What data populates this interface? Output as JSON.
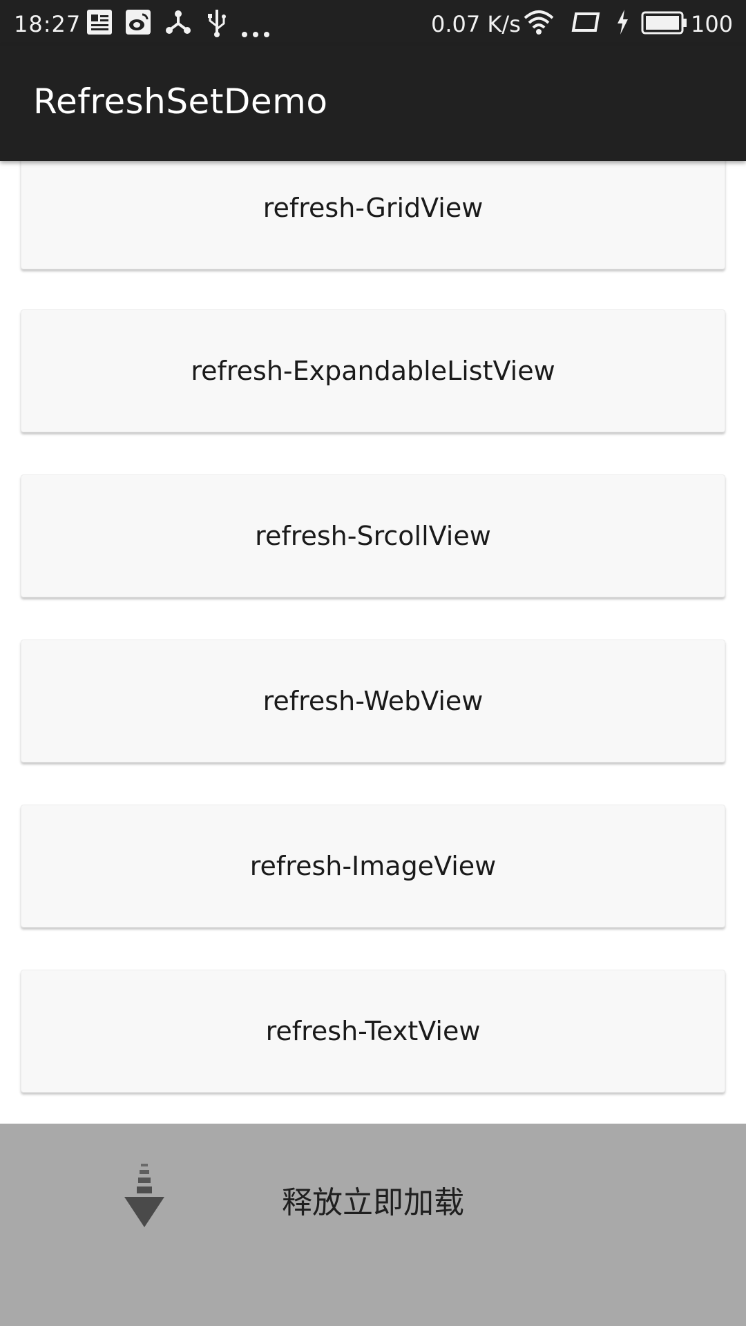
{
  "status_bar": {
    "time": "18:27",
    "speed": "0.07 K/s",
    "battery": "100",
    "icons": [
      "news-icon",
      "weibo-icon",
      "share-icon",
      "usb-icon",
      "more-dots-icon",
      "wifi-icon",
      "tablet-icon",
      "charging-icon",
      "battery-icon"
    ]
  },
  "app_bar": {
    "title": "RefreshSetDemo",
    "color": "#212121"
  },
  "list": {
    "items": [
      {
        "label": "refresh-GridView"
      },
      {
        "label": "refresh-ExpandableListView"
      },
      {
        "label": "refresh-SrcollView"
      },
      {
        "label": "refresh-WebView"
      },
      {
        "label": "refresh-ImageView"
      },
      {
        "label": "refresh-TextView"
      }
    ]
  },
  "load_footer": {
    "text": "释放立即加载",
    "icon": "down-arrow-icon",
    "background": "#a9a9a9"
  }
}
